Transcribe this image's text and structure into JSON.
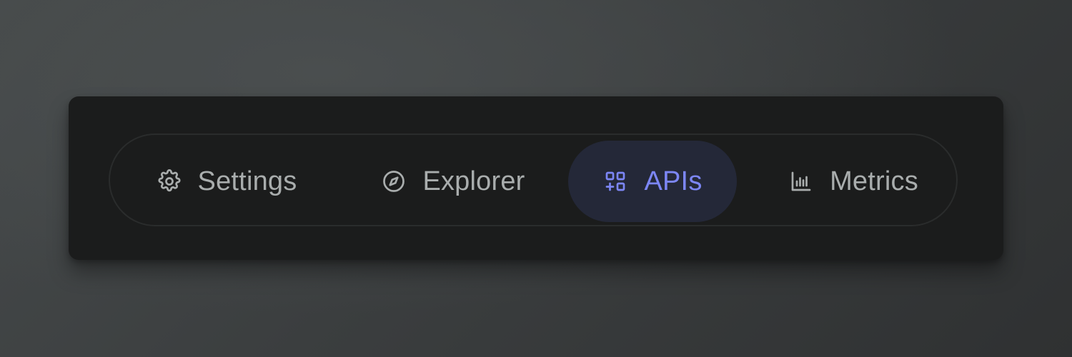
{
  "nav": {
    "active_tab": "APIs",
    "accent_color": "#7c86f5",
    "tabs": [
      {
        "label": "Settings",
        "icon": "gear-icon",
        "active": false
      },
      {
        "label": "Explorer",
        "icon": "compass-icon",
        "active": false
      },
      {
        "label": "APIs",
        "icon": "grid-plus-icon",
        "active": true
      },
      {
        "label": "Metrics",
        "icon": "bar-chart-icon",
        "active": false
      }
    ]
  }
}
